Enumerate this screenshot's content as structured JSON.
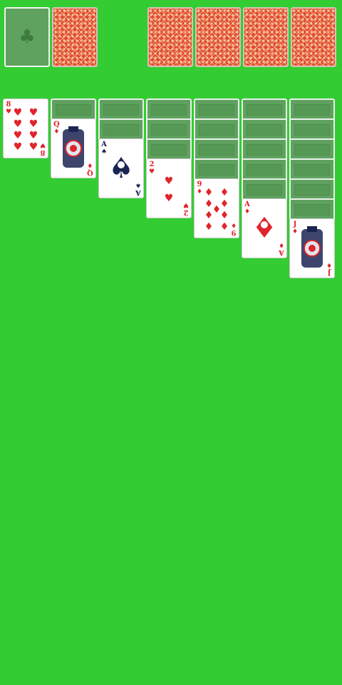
{
  "colors": {
    "felt": "#33cc33",
    "empty_slot": "#5fa25f",
    "card_back": "#e04a2c",
    "red_suit": "#e0242c",
    "black_suit": "#1b2552"
  },
  "stock": {
    "label": "",
    "icon": "club-icon",
    "suit_glyph": "♣"
  },
  "waste": {
    "face_down": true
  },
  "foundations": [
    {
      "face_down": true
    },
    {
      "face_down": true
    },
    {
      "face_down": true
    },
    {
      "face_down": true
    }
  ],
  "tableau": [
    {
      "face_down_count": 0,
      "top_card": {
        "rank": "8",
        "suit": "♥",
        "color": "red",
        "suit_name": "hearts"
      }
    },
    {
      "face_down_count": 1,
      "top_card": {
        "rank": "Q",
        "suit": "♦",
        "color": "red",
        "suit_name": "diamonds"
      }
    },
    {
      "face_down_count": 2,
      "top_card": {
        "rank": "A",
        "suit": "♠",
        "color": "black",
        "suit_name": "spades"
      }
    },
    {
      "face_down_count": 3,
      "top_card": {
        "rank": "2",
        "suit": "♥",
        "color": "red",
        "suit_name": "hearts"
      }
    },
    {
      "face_down_count": 4,
      "top_card": {
        "rank": "9",
        "suit": "♦",
        "color": "red",
        "suit_name": "diamonds"
      }
    },
    {
      "face_down_count": 5,
      "top_card": {
        "rank": "A",
        "suit": "♦",
        "color": "red",
        "suit_name": "diamonds"
      }
    },
    {
      "face_down_count": 6,
      "top_card": {
        "rank": "J",
        "suit": "♦",
        "color": "red",
        "suit_name": "diamonds"
      }
    }
  ]
}
